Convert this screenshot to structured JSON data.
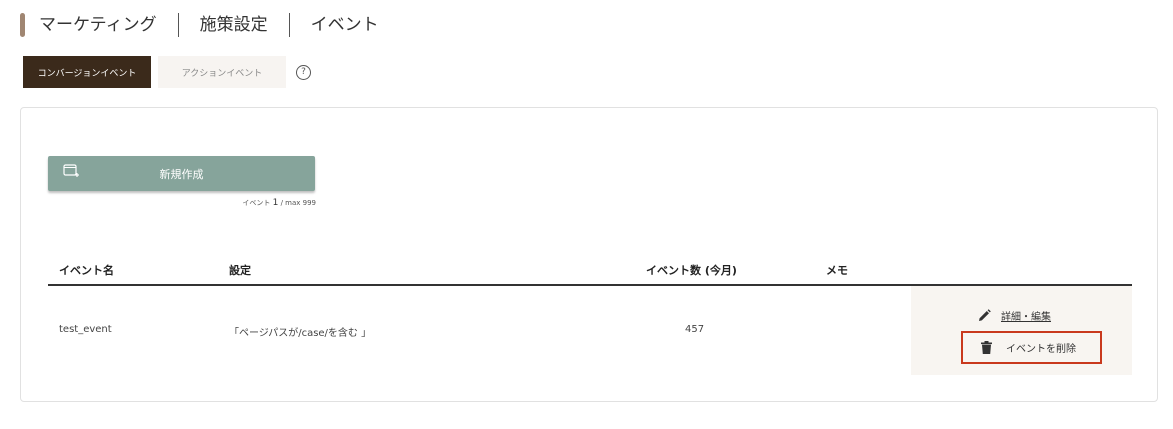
{
  "header": {
    "breadcrumb": [
      "マーケティング",
      "施策設定",
      "イベント"
    ]
  },
  "tabs": {
    "active_label": "コンバージョンイベント",
    "inactive_label": "アクションイベント",
    "help_glyph": "?"
  },
  "create": {
    "label": "新規作成",
    "count_prefix": "イベント",
    "count_value": "1",
    "count_suffix": "/ max 999"
  },
  "table": {
    "headers": [
      "イベント名",
      "設定",
      "イベント数 (今月)",
      "メモ"
    ],
    "rows": [
      {
        "name": "test_event",
        "setting": "「ページパスが/case/を含む 」",
        "count": "457",
        "memo": "",
        "edit_label": "詳細・編集",
        "delete_label": "イベントを削除"
      }
    ]
  },
  "colors": {
    "accent": "#a08672",
    "active_tab": "#3b2a1b",
    "create_button": "#86a49b",
    "highlight_border": "#c9391d"
  },
  "icons": [
    "help-icon",
    "new-window-icon",
    "pencil-icon",
    "trash-icon"
  ]
}
